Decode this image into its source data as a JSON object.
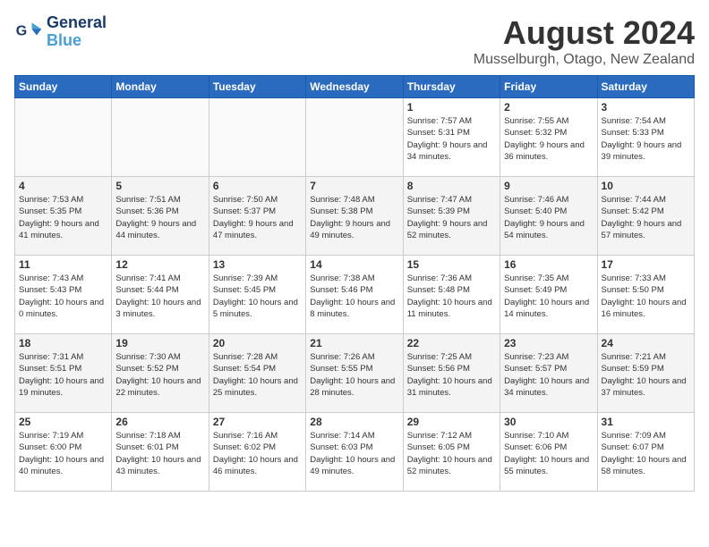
{
  "header": {
    "logo_line1": "General",
    "logo_line2": "Blue",
    "month_year": "August 2024",
    "location": "Musselburgh, Otago, New Zealand"
  },
  "days_of_week": [
    "Sunday",
    "Monday",
    "Tuesday",
    "Wednesday",
    "Thursday",
    "Friday",
    "Saturday"
  ],
  "weeks": [
    [
      {
        "day": "",
        "sunrise": "",
        "sunset": "",
        "daylight": ""
      },
      {
        "day": "",
        "sunrise": "",
        "sunset": "",
        "daylight": ""
      },
      {
        "day": "",
        "sunrise": "",
        "sunset": "",
        "daylight": ""
      },
      {
        "day": "",
        "sunrise": "",
        "sunset": "",
        "daylight": ""
      },
      {
        "day": "1",
        "sunrise": "Sunrise: 7:57 AM",
        "sunset": "Sunset: 5:31 PM",
        "daylight": "Daylight: 9 hours and 34 minutes."
      },
      {
        "day": "2",
        "sunrise": "Sunrise: 7:55 AM",
        "sunset": "Sunset: 5:32 PM",
        "daylight": "Daylight: 9 hours and 36 minutes."
      },
      {
        "day": "3",
        "sunrise": "Sunrise: 7:54 AM",
        "sunset": "Sunset: 5:33 PM",
        "daylight": "Daylight: 9 hours and 39 minutes."
      }
    ],
    [
      {
        "day": "4",
        "sunrise": "Sunrise: 7:53 AM",
        "sunset": "Sunset: 5:35 PM",
        "daylight": "Daylight: 9 hours and 41 minutes."
      },
      {
        "day": "5",
        "sunrise": "Sunrise: 7:51 AM",
        "sunset": "Sunset: 5:36 PM",
        "daylight": "Daylight: 9 hours and 44 minutes."
      },
      {
        "day": "6",
        "sunrise": "Sunrise: 7:50 AM",
        "sunset": "Sunset: 5:37 PM",
        "daylight": "Daylight: 9 hours and 47 minutes."
      },
      {
        "day": "7",
        "sunrise": "Sunrise: 7:48 AM",
        "sunset": "Sunset: 5:38 PM",
        "daylight": "Daylight: 9 hours and 49 minutes."
      },
      {
        "day": "8",
        "sunrise": "Sunrise: 7:47 AM",
        "sunset": "Sunset: 5:39 PM",
        "daylight": "Daylight: 9 hours and 52 minutes."
      },
      {
        "day": "9",
        "sunrise": "Sunrise: 7:46 AM",
        "sunset": "Sunset: 5:40 PM",
        "daylight": "Daylight: 9 hours and 54 minutes."
      },
      {
        "day": "10",
        "sunrise": "Sunrise: 7:44 AM",
        "sunset": "Sunset: 5:42 PM",
        "daylight": "Daylight: 9 hours and 57 minutes."
      }
    ],
    [
      {
        "day": "11",
        "sunrise": "Sunrise: 7:43 AM",
        "sunset": "Sunset: 5:43 PM",
        "daylight": "Daylight: 10 hours and 0 minutes."
      },
      {
        "day": "12",
        "sunrise": "Sunrise: 7:41 AM",
        "sunset": "Sunset: 5:44 PM",
        "daylight": "Daylight: 10 hours and 3 minutes."
      },
      {
        "day": "13",
        "sunrise": "Sunrise: 7:39 AM",
        "sunset": "Sunset: 5:45 PM",
        "daylight": "Daylight: 10 hours and 5 minutes."
      },
      {
        "day": "14",
        "sunrise": "Sunrise: 7:38 AM",
        "sunset": "Sunset: 5:46 PM",
        "daylight": "Daylight: 10 hours and 8 minutes."
      },
      {
        "day": "15",
        "sunrise": "Sunrise: 7:36 AM",
        "sunset": "Sunset: 5:48 PM",
        "daylight": "Daylight: 10 hours and 11 minutes."
      },
      {
        "day": "16",
        "sunrise": "Sunrise: 7:35 AM",
        "sunset": "Sunset: 5:49 PM",
        "daylight": "Daylight: 10 hours and 14 minutes."
      },
      {
        "day": "17",
        "sunrise": "Sunrise: 7:33 AM",
        "sunset": "Sunset: 5:50 PM",
        "daylight": "Daylight: 10 hours and 16 minutes."
      }
    ],
    [
      {
        "day": "18",
        "sunrise": "Sunrise: 7:31 AM",
        "sunset": "Sunset: 5:51 PM",
        "daylight": "Daylight: 10 hours and 19 minutes."
      },
      {
        "day": "19",
        "sunrise": "Sunrise: 7:30 AM",
        "sunset": "Sunset: 5:52 PM",
        "daylight": "Daylight: 10 hours and 22 minutes."
      },
      {
        "day": "20",
        "sunrise": "Sunrise: 7:28 AM",
        "sunset": "Sunset: 5:54 PM",
        "daylight": "Daylight: 10 hours and 25 minutes."
      },
      {
        "day": "21",
        "sunrise": "Sunrise: 7:26 AM",
        "sunset": "Sunset: 5:55 PM",
        "daylight": "Daylight: 10 hours and 28 minutes."
      },
      {
        "day": "22",
        "sunrise": "Sunrise: 7:25 AM",
        "sunset": "Sunset: 5:56 PM",
        "daylight": "Daylight: 10 hours and 31 minutes."
      },
      {
        "day": "23",
        "sunrise": "Sunrise: 7:23 AM",
        "sunset": "Sunset: 5:57 PM",
        "daylight": "Daylight: 10 hours and 34 minutes."
      },
      {
        "day": "24",
        "sunrise": "Sunrise: 7:21 AM",
        "sunset": "Sunset: 5:59 PM",
        "daylight": "Daylight: 10 hours and 37 minutes."
      }
    ],
    [
      {
        "day": "25",
        "sunrise": "Sunrise: 7:19 AM",
        "sunset": "Sunset: 6:00 PM",
        "daylight": "Daylight: 10 hours and 40 minutes."
      },
      {
        "day": "26",
        "sunrise": "Sunrise: 7:18 AM",
        "sunset": "Sunset: 6:01 PM",
        "daylight": "Daylight: 10 hours and 43 minutes."
      },
      {
        "day": "27",
        "sunrise": "Sunrise: 7:16 AM",
        "sunset": "Sunset: 6:02 PM",
        "daylight": "Daylight: 10 hours and 46 minutes."
      },
      {
        "day": "28",
        "sunrise": "Sunrise: 7:14 AM",
        "sunset": "Sunset: 6:03 PM",
        "daylight": "Daylight: 10 hours and 49 minutes."
      },
      {
        "day": "29",
        "sunrise": "Sunrise: 7:12 AM",
        "sunset": "Sunset: 6:05 PM",
        "daylight": "Daylight: 10 hours and 52 minutes."
      },
      {
        "day": "30",
        "sunrise": "Sunrise: 7:10 AM",
        "sunset": "Sunset: 6:06 PM",
        "daylight": "Daylight: 10 hours and 55 minutes."
      },
      {
        "day": "31",
        "sunrise": "Sunrise: 7:09 AM",
        "sunset": "Sunset: 6:07 PM",
        "daylight": "Daylight: 10 hours and 58 minutes."
      }
    ]
  ]
}
